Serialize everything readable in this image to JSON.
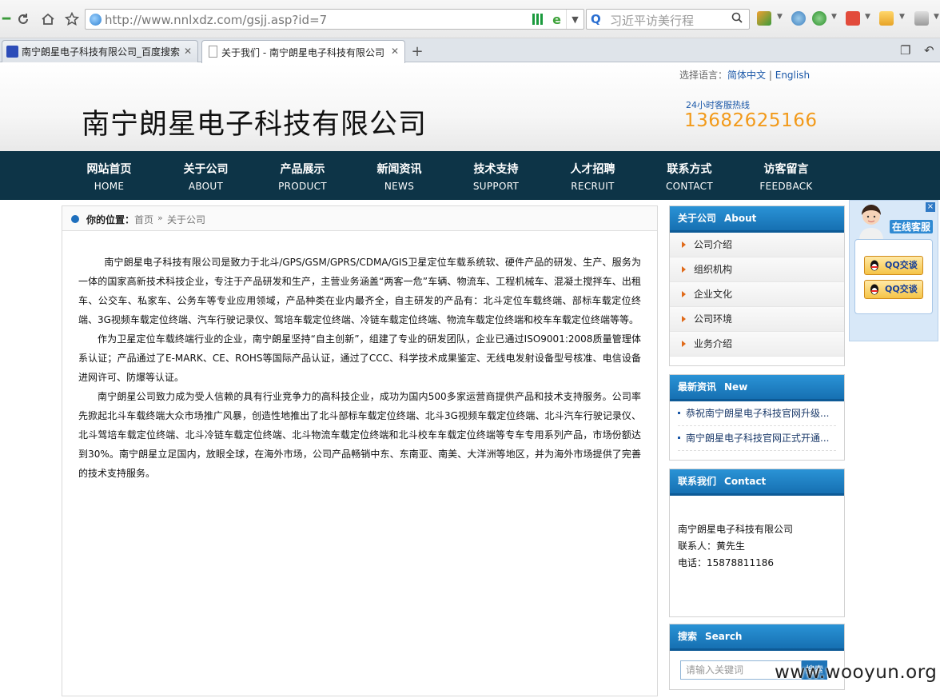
{
  "browser": {
    "url": "http://www.nnlxdz.com/gsjj.asp?id=7",
    "search_placeholder": "习近平访美行程",
    "tabs": [
      {
        "label": "南宁朗星电子科技有限公司_百度搜索",
        "active": false
      },
      {
        "label": "关于我们 - 南宁朗星电子科技有限公司",
        "active": true
      }
    ]
  },
  "header": {
    "company_name": "南宁朗星电子科技有限公司",
    "lang_label": "选择语言：",
    "lang_cn": "简体中文",
    "lang_sep": "|",
    "lang_en": "English",
    "hotline_label": "24小时客服热线",
    "hotline": "13682625166"
  },
  "nav": [
    {
      "cn": "网站首页",
      "en": "HOME"
    },
    {
      "cn": "关于公司",
      "en": "ABOUT"
    },
    {
      "cn": "产品展示",
      "en": "PRODUCT"
    },
    {
      "cn": "新闻资讯",
      "en": "NEWS"
    },
    {
      "cn": "技术支持",
      "en": "SUPPORT"
    },
    {
      "cn": "人才招聘",
      "en": "RECRUIT"
    },
    {
      "cn": "联系方式",
      "en": "CONTACT"
    },
    {
      "cn": "访客留言",
      "en": "FEEDBACK"
    }
  ],
  "breadcrumb": {
    "label": "你的位置：",
    "home": "首页",
    "sep": "»",
    "current": "关于公司"
  },
  "article": [
    "南宁朗星电子科技有限公司是致力于北斗/GPS/GSM/GPRS/CDMA/GIS卫星定位车载系统软、硬件产品的研发、生产、服务为一体的国家高新技术科技企业，专注于产品研发和生产，主营业务涵盖“两客一危”车辆、物流车、工程机械车、混凝土搅拌车、出租车、公交车、私家车、公务车等专业应用领域，产品种类在业内最齐全，自主研发的产品有：北斗定位车载终端、部标车载定位终端、3G视频车载定位终端、汽车行驶记录仪、驾培车载定位终端、冷链车载定位终端、物流车载定位终端和校车车载定位终端等等。",
    "作为卫星定位车载终端行业的企业，南宁朗星坚持“自主创新”，组建了专业的研发团队，企业已通过ISO9001:2008质量管理体系认证；产品通过了E-MARK、CE、ROHS等国际产品认证，通过了CCC、科学技术成果鉴定、无线电发射设备型号核准、电信设备进网许可、防爆等认证。",
    "南宁朗星公司致力成为受人信赖的具有行业竞争力的高科技企业，成功为国内500多家运营商提供产品和技术支持服务。公司率先掀起北斗车载终端大众市场推广风暴，创造性地推出了北斗部标车载定位终端、北斗3G视频车载定位终端、北斗汽车行驶记录仪、北斗驾培车载定位终端、北斗冷链车载定位终端、北斗物流车载定位终端和北斗校车车载定位终端等专车专用系列产品，市场份额达到30%。南宁朗星立足国内，放眼全球，在海外市场，公司产品畅销中东、东南亚、南美、大洋洲等地区，并为海外市场提供了完善的技术支持服务。"
  ],
  "about_box": {
    "title_cn": "关于公司",
    "title_en": "About",
    "items": [
      "公司介绍",
      "组织机构",
      "企业文化",
      "公司环境",
      "业务介绍"
    ]
  },
  "news_box": {
    "title_cn": "最新资讯",
    "title_en": "New",
    "items": [
      "恭祝南宁朗星电子科技官网升级...",
      "南宁朗星电子科技官网正式开通..."
    ]
  },
  "contact_box": {
    "title_cn": "联系我们",
    "title_en": "Contact",
    "company": "南宁朗星电子科技有限公司",
    "person": "联系人：黄先生",
    "phone": "电话：15878811186"
  },
  "search_box": {
    "title_cn": "搜索",
    "title_en": "Search",
    "placeholder": "请输入关键词",
    "button": "搜索"
  },
  "chat": {
    "title": "在线客服",
    "close": "×",
    "qq_buttons": [
      "QQ交谈",
      "QQ交谈"
    ]
  },
  "watermark": "www.wooyun.org",
  "colors": {
    "nav_bg": "#0d3447",
    "box_head": "#1f7fc3",
    "hotline": "#f29a1a",
    "link": "#1b58a8"
  }
}
